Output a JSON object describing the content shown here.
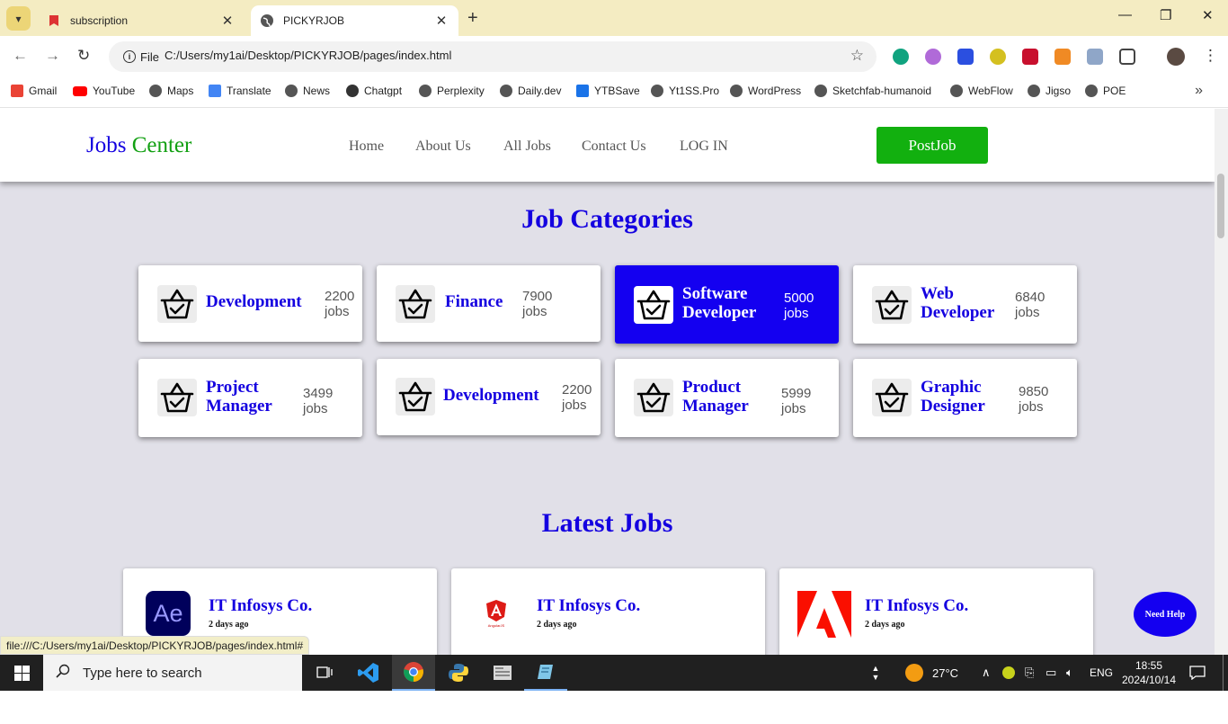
{
  "browser": {
    "tabs": [
      {
        "title": "subscription",
        "active": false
      },
      {
        "title": "PICKYRJOB",
        "active": true
      }
    ],
    "omnibox": {
      "scheme_label": "File",
      "url": "C:/Users/my1ai/Desktop/PICKYRJOB/pages/index.html"
    },
    "bookmarks": [
      "Gmail",
      "YouTube",
      "Maps",
      "Translate",
      "News",
      "Chatgpt",
      "Perplexity",
      "Daily.dev",
      "YTBSave",
      "Yt1SS.Pro",
      "WordPress",
      "Sketchfab-humanoid",
      "WebFlow",
      "Jigso",
      "POE"
    ],
    "status_url": "file:///C:/Users/my1ai/Desktop/PICKYRJOB/pages/index.html#"
  },
  "site": {
    "logo": {
      "part1": "Jobs",
      "part2": "Center"
    },
    "nav": [
      "Home",
      "About Us",
      "All Jobs",
      "Contact Us",
      "LOG IN"
    ],
    "post_job": "PostJob",
    "categories_title": "Job Categories",
    "categories": [
      {
        "name_line1": "Development",
        "name_line2": "",
        "count": "2200",
        "unit": "jobs",
        "active": false
      },
      {
        "name_line1": "Finance",
        "name_line2": "",
        "count": "7900",
        "unit": "jobs",
        "active": false
      },
      {
        "name_line1": "Software",
        "name_line2": "Developer",
        "count": "5000",
        "unit": "jobs",
        "active": true
      },
      {
        "name_line1": "Web",
        "name_line2": "Developer",
        "count": "6840",
        "unit": "jobs",
        "active": false
      },
      {
        "name_line1": "Project",
        "name_line2": "Manager",
        "count": "3499",
        "unit": "jobs",
        "active": false
      },
      {
        "name_line1": "Development",
        "name_line2": "",
        "count": "2200",
        "unit": "jobs",
        "active": false
      },
      {
        "name_line1": "Product",
        "name_line2": "Manager",
        "count": "5999",
        "unit": "jobs",
        "active": false
      },
      {
        "name_line1": "Graphic",
        "name_line2": "Designer",
        "count": "9850",
        "unit": "jobs",
        "active": false
      }
    ],
    "latest_title": "Latest Jobs",
    "jobs": [
      {
        "company": "IT Infosys Co.",
        "posted": "2 days ago",
        "logo": "after-effects-logo"
      },
      {
        "company": "IT Infosys Co.",
        "posted": "2 days ago",
        "logo": "angularjs-logo"
      },
      {
        "company": "IT Infosys Co.",
        "posted": "2 days ago",
        "logo": "adobe-logo"
      }
    ],
    "need_help": "Need Help",
    "logo_ae_text": "Ae",
    "logo_angular_text": "AngularJS"
  },
  "taskbar": {
    "search_placeholder": "Type here to search",
    "weather": "27°C",
    "language": "ENG",
    "time": "18:55",
    "date": "2024/10/14"
  }
}
